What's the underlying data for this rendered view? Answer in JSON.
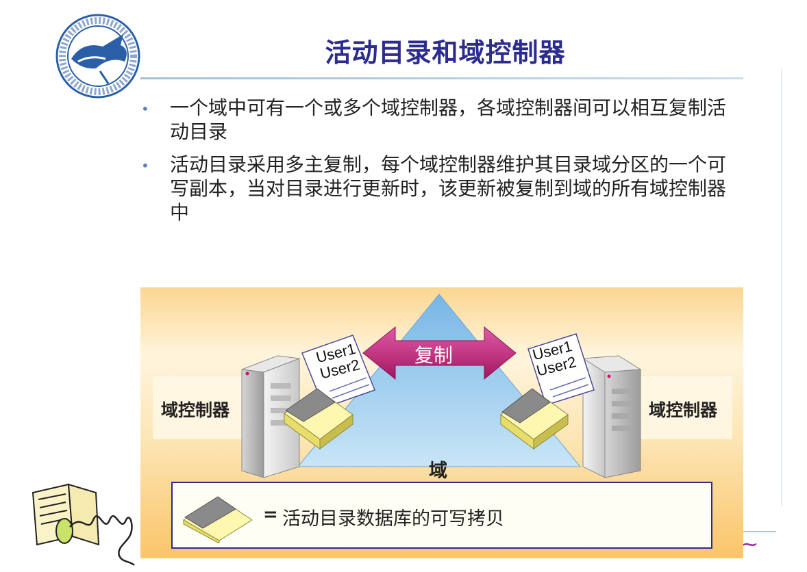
{
  "slide": {
    "title": "活动目录和域控制器",
    "bullets": [
      "一个域中可有一个或多个域控制器，各域控制器间可以相互复制活动目录",
      "活动目录采用多主复制，每个域控制器维护其目录域分区的一个可写副本，当对目录进行更新时，该更新被复制到域的所有域控制器中"
    ],
    "bullet_icon": "dot-icon"
  },
  "diagram": {
    "left_dc_label": "域控制器",
    "right_dc_label": "域控制器",
    "replicate_label": "复制",
    "domain_label": "域",
    "left_doc_lines": [
      "User1",
      "User2"
    ],
    "right_doc_lines": [
      "User1",
      "User2"
    ],
    "legend_equals": "=",
    "legend_text": "活动目录数据库的可写拷贝"
  },
  "colors": {
    "title": "#2b2b90",
    "diagram_bg_top": "#fff7e2",
    "diagram_bg_bottom": "#f9c56a",
    "triangle": "#a9d3f0",
    "arrow": "#c0277e",
    "legend_border": "#2b2b90"
  }
}
